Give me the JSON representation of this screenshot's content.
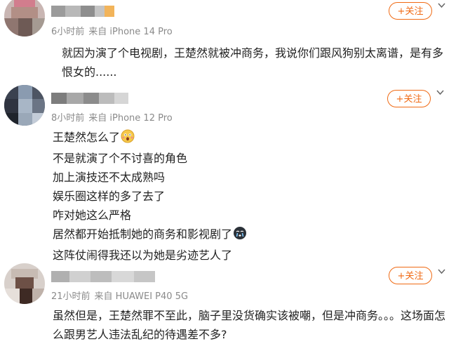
{
  "posts": [
    {
      "time": "6小时前",
      "source": "来自 iPhone 14 Pro",
      "follow_label": "+关注",
      "lines": [
        "就因为演了个电视剧，王楚然就被冲商务，我说你们跟风狗别太离谱，是有多恨女的......"
      ]
    },
    {
      "time": "8小时前",
      "source": "来自 iPhone 12 Pro",
      "follow_label": "+关注",
      "lines": [
        "王楚然怎么了",
        "不是就演了个不讨喜的角色",
        "加上演技还不太成熟吗",
        "娱乐圈这样的多了去了",
        "咋对她这么严格",
        "居然都开始抵制她的商务和影视剧了",
        "这阵仗闹得我还以为她是劣迹艺人了"
      ],
      "emojis": [
        "shocked-face-emoji",
        "crying-face-emoji"
      ]
    },
    {
      "time": "21小时前",
      "source": "来自 HUAWEI P40 5G",
      "follow_label": "+关注",
      "lines": [
        "虽然但是，王楚然罪不至此，脑子里没货确实该被嘲，但是冲商务。。。这场面怎么跟男艺人违法乱纪的待遇差不多?"
      ]
    }
  ],
  "colors": {
    "accent": "#f06a14",
    "meta": "#8a8a8a",
    "text": "#222222"
  },
  "icons": {
    "more": "chevron-down-icon"
  }
}
